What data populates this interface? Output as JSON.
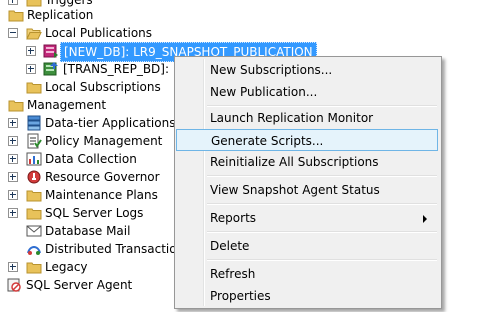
{
  "tree": {
    "triggers": "Triggers",
    "replication": "Replication",
    "local_publications": "Local Publications",
    "pub_new_db": "[NEW_DB]: LR9_SNAPSHOT_PUBLICATION",
    "pub_trans_rep": "[TRANS_REP_BD]: LR",
    "local_subscriptions": "Local Subscriptions",
    "management": "Management",
    "data_tier": "Data-tier Applications",
    "policy_management": "Policy Management",
    "data_collection": "Data Collection",
    "resource_governor": "Resource Governor",
    "maintenance_plans": "Maintenance Plans",
    "sql_server_logs": "SQL Server Logs",
    "database_mail": "Database Mail",
    "distributed_tc": "Distributed Transaction C",
    "legacy": "Legacy",
    "sql_server_agent": "SQL Server Agent"
  },
  "context_menu": {
    "new_subscriptions": "New Subscriptions...",
    "new_publication": "New Publication...",
    "launch_monitor": "Launch Replication Monitor",
    "generate_scripts": "Generate Scripts...",
    "reinitialize": "Reinitialize All Subscriptions",
    "view_snapshot_status": "View Snapshot Agent Status",
    "reports": "Reports",
    "delete": "Delete",
    "refresh": "Refresh",
    "properties": "Properties"
  },
  "colors": {
    "selection": "#3399ff",
    "folder": "#e8c25a",
    "menu_hover": "#e5f3fb",
    "menu_hover_border": "#6fb5e6"
  }
}
